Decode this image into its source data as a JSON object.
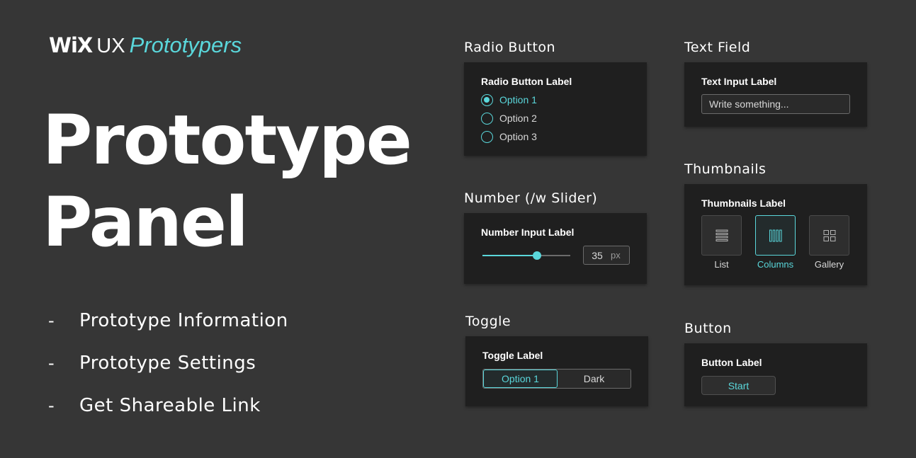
{
  "brand": {
    "wix": "WiX",
    "ux": "UX",
    "prototypers": "Prototypers"
  },
  "title": {
    "line1": "Prototype",
    "line2": "Panel"
  },
  "bullets": [
    {
      "dash": "-",
      "text": "Prototype Information"
    },
    {
      "dash": "-",
      "text": "Prototype Settings"
    },
    {
      "dash": "-",
      "text": "Get Shareable Link"
    }
  ],
  "radio": {
    "heading": "Radio Button",
    "label": "Radio Button Label",
    "options": [
      "Option 1",
      "Option 2",
      "Option 3"
    ],
    "selected": "Option 1"
  },
  "number": {
    "heading": "Number (/w Slider)",
    "label": "Number Input Label",
    "value": "35",
    "unit": "px",
    "slider_fraction": 0.62
  },
  "toggle": {
    "heading": "Toggle",
    "label": "Toggle Label",
    "options": [
      "Option 1",
      "Dark"
    ],
    "selected": "Option 1"
  },
  "text_field": {
    "heading": "Text Field",
    "label": "Text Input Label",
    "placeholder": "Write something..."
  },
  "thumbnails": {
    "heading": "Thumbnails",
    "label": "Thumbnails Label",
    "items": [
      {
        "caption": "List",
        "icon": "list-icon"
      },
      {
        "caption": "Columns",
        "icon": "columns-icon"
      },
      {
        "caption": "Gallery",
        "icon": "gallery-icon"
      }
    ],
    "selected": "Columns"
  },
  "button": {
    "heading": "Button",
    "label": "Button Label",
    "text": "Start"
  },
  "colors": {
    "background": "#363636",
    "panel": "#1f1f1f",
    "accent": "#5ad7db",
    "text": "#ffffff"
  }
}
